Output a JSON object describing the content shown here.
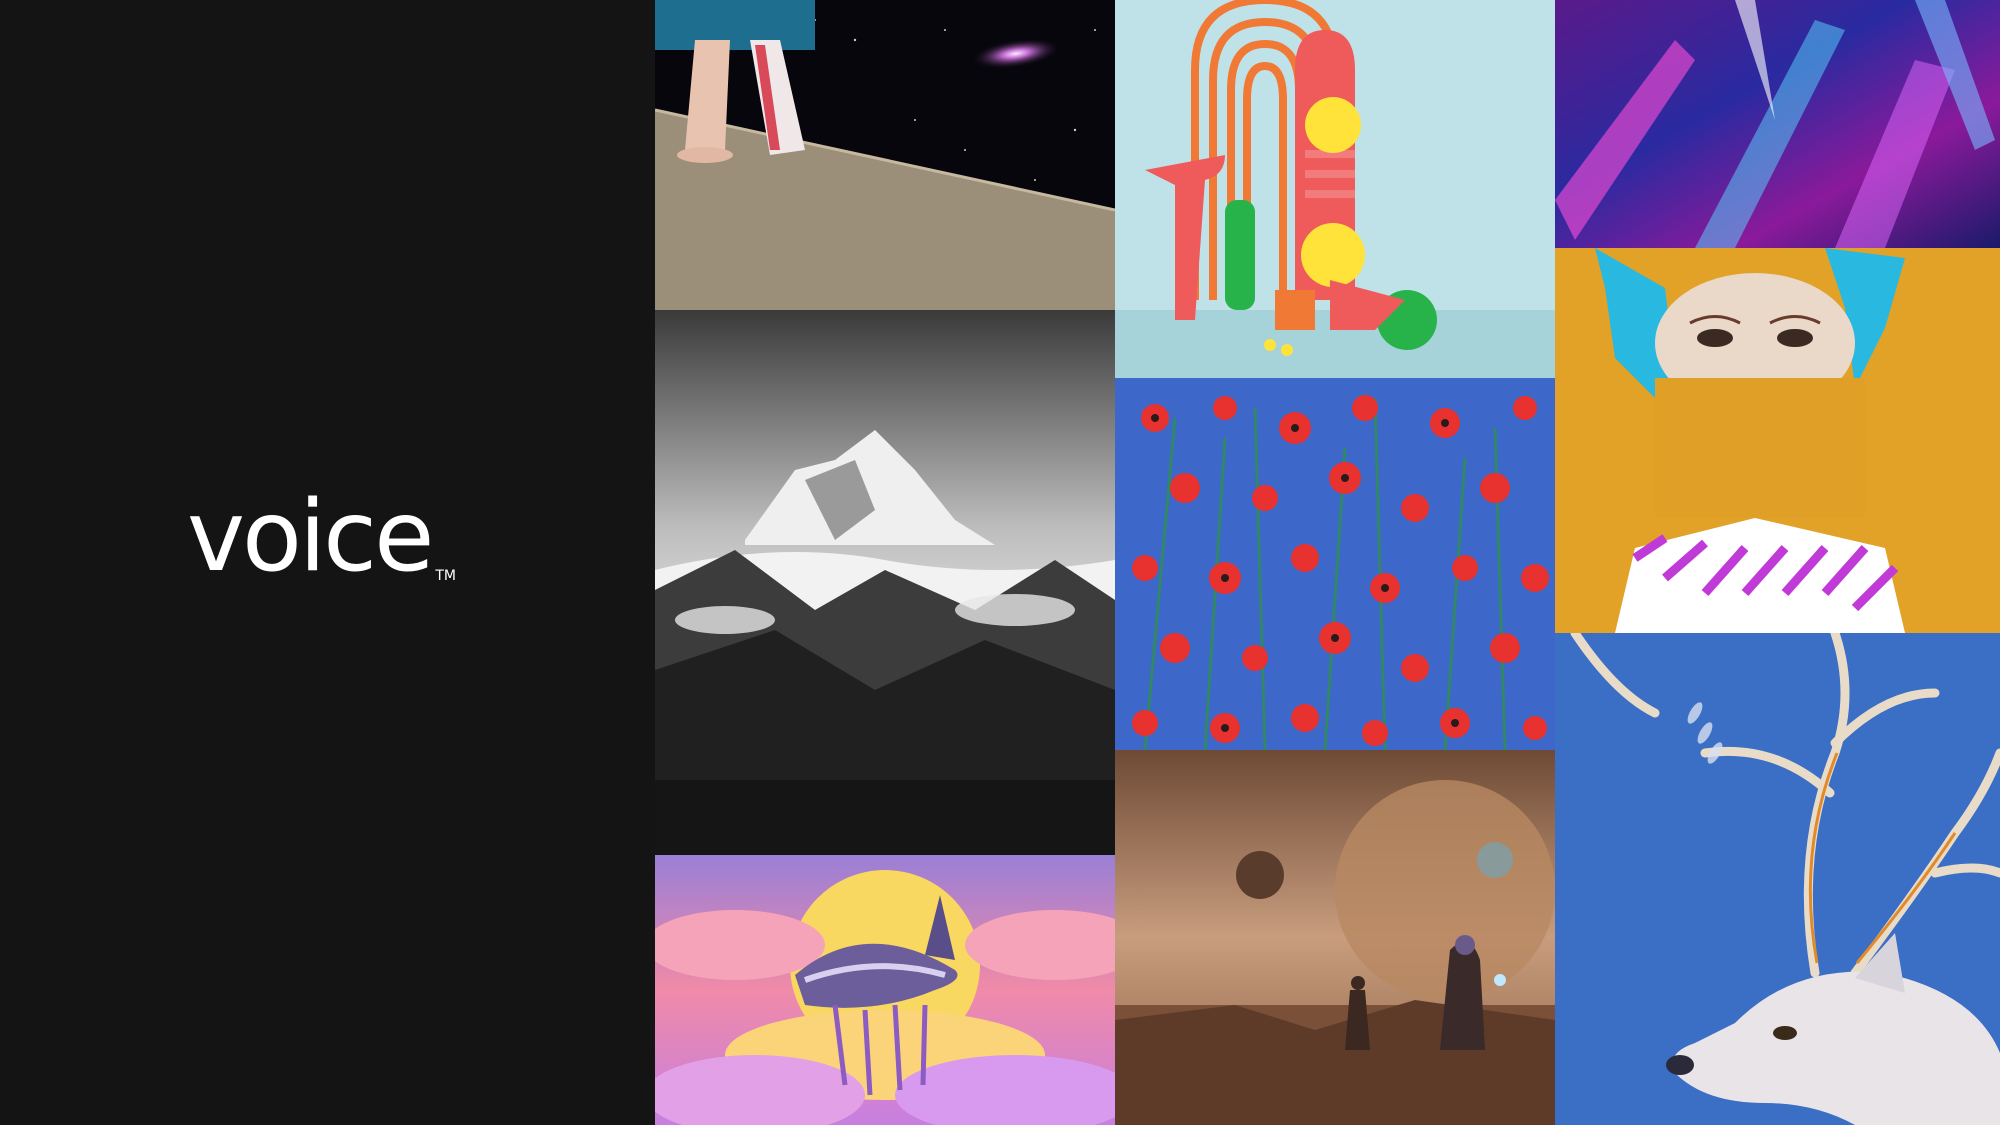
{
  "brand": {
    "wordmark": "voice",
    "trademark": "TM"
  },
  "gallery": {
    "tiles": [
      {
        "icon": "astronaut-legs-galaxy-image"
      },
      {
        "icon": "snowy-mountain-peak-image"
      },
      {
        "icon": "flying-whale-moon-image"
      },
      {
        "icon": "colorful-arches-spheres-image"
      },
      {
        "icon": "red-poppies-painting-image"
      },
      {
        "icon": "desert-planets-travelers-image"
      },
      {
        "icon": "holographic-abstract-image"
      },
      {
        "icon": "blue-hair-portrait-image"
      },
      {
        "icon": "white-reindeer-painting-image"
      }
    ]
  }
}
